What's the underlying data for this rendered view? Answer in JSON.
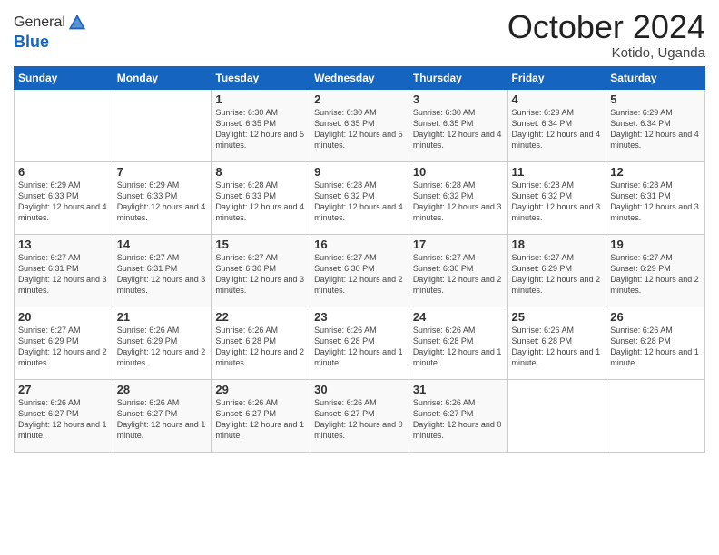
{
  "logo": {
    "general": "General",
    "blue": "Blue"
  },
  "header": {
    "month": "October 2024",
    "location": "Kotido, Uganda"
  },
  "weekdays": [
    "Sunday",
    "Monday",
    "Tuesday",
    "Wednesday",
    "Thursday",
    "Friday",
    "Saturday"
  ],
  "weeks": [
    [
      {
        "day": "",
        "info": ""
      },
      {
        "day": "",
        "info": ""
      },
      {
        "day": "1",
        "info": "Sunrise: 6:30 AM\nSunset: 6:35 PM\nDaylight: 12 hours\nand 5 minutes."
      },
      {
        "day": "2",
        "info": "Sunrise: 6:30 AM\nSunset: 6:35 PM\nDaylight: 12 hours\nand 5 minutes."
      },
      {
        "day": "3",
        "info": "Sunrise: 6:30 AM\nSunset: 6:35 PM\nDaylight: 12 hours\nand 4 minutes."
      },
      {
        "day": "4",
        "info": "Sunrise: 6:29 AM\nSunset: 6:34 PM\nDaylight: 12 hours\nand 4 minutes."
      },
      {
        "day": "5",
        "info": "Sunrise: 6:29 AM\nSunset: 6:34 PM\nDaylight: 12 hours\nand 4 minutes."
      }
    ],
    [
      {
        "day": "6",
        "info": "Sunrise: 6:29 AM\nSunset: 6:33 PM\nDaylight: 12 hours\nand 4 minutes."
      },
      {
        "day": "7",
        "info": "Sunrise: 6:29 AM\nSunset: 6:33 PM\nDaylight: 12 hours\nand 4 minutes."
      },
      {
        "day": "8",
        "info": "Sunrise: 6:28 AM\nSunset: 6:33 PM\nDaylight: 12 hours\nand 4 minutes."
      },
      {
        "day": "9",
        "info": "Sunrise: 6:28 AM\nSunset: 6:32 PM\nDaylight: 12 hours\nand 4 minutes."
      },
      {
        "day": "10",
        "info": "Sunrise: 6:28 AM\nSunset: 6:32 PM\nDaylight: 12 hours\nand 3 minutes."
      },
      {
        "day": "11",
        "info": "Sunrise: 6:28 AM\nSunset: 6:32 PM\nDaylight: 12 hours\nand 3 minutes."
      },
      {
        "day": "12",
        "info": "Sunrise: 6:28 AM\nSunset: 6:31 PM\nDaylight: 12 hours\nand 3 minutes."
      }
    ],
    [
      {
        "day": "13",
        "info": "Sunrise: 6:27 AM\nSunset: 6:31 PM\nDaylight: 12 hours\nand 3 minutes."
      },
      {
        "day": "14",
        "info": "Sunrise: 6:27 AM\nSunset: 6:31 PM\nDaylight: 12 hours\nand 3 minutes."
      },
      {
        "day": "15",
        "info": "Sunrise: 6:27 AM\nSunset: 6:30 PM\nDaylight: 12 hours\nand 3 minutes."
      },
      {
        "day": "16",
        "info": "Sunrise: 6:27 AM\nSunset: 6:30 PM\nDaylight: 12 hours\nand 2 minutes."
      },
      {
        "day": "17",
        "info": "Sunrise: 6:27 AM\nSunset: 6:30 PM\nDaylight: 12 hours\nand 2 minutes."
      },
      {
        "day": "18",
        "info": "Sunrise: 6:27 AM\nSunset: 6:29 PM\nDaylight: 12 hours\nand 2 minutes."
      },
      {
        "day": "19",
        "info": "Sunrise: 6:27 AM\nSunset: 6:29 PM\nDaylight: 12 hours\nand 2 minutes."
      }
    ],
    [
      {
        "day": "20",
        "info": "Sunrise: 6:27 AM\nSunset: 6:29 PM\nDaylight: 12 hours\nand 2 minutes."
      },
      {
        "day": "21",
        "info": "Sunrise: 6:26 AM\nSunset: 6:29 PM\nDaylight: 12 hours\nand 2 minutes."
      },
      {
        "day": "22",
        "info": "Sunrise: 6:26 AM\nSunset: 6:28 PM\nDaylight: 12 hours\nand 2 minutes."
      },
      {
        "day": "23",
        "info": "Sunrise: 6:26 AM\nSunset: 6:28 PM\nDaylight: 12 hours\nand 1 minute."
      },
      {
        "day": "24",
        "info": "Sunrise: 6:26 AM\nSunset: 6:28 PM\nDaylight: 12 hours\nand 1 minute."
      },
      {
        "day": "25",
        "info": "Sunrise: 6:26 AM\nSunset: 6:28 PM\nDaylight: 12 hours\nand 1 minute."
      },
      {
        "day": "26",
        "info": "Sunrise: 6:26 AM\nSunset: 6:28 PM\nDaylight: 12 hours\nand 1 minute."
      }
    ],
    [
      {
        "day": "27",
        "info": "Sunrise: 6:26 AM\nSunset: 6:27 PM\nDaylight: 12 hours\nand 1 minute."
      },
      {
        "day": "28",
        "info": "Sunrise: 6:26 AM\nSunset: 6:27 PM\nDaylight: 12 hours\nand 1 minute."
      },
      {
        "day": "29",
        "info": "Sunrise: 6:26 AM\nSunset: 6:27 PM\nDaylight: 12 hours\nand 1 minute."
      },
      {
        "day": "30",
        "info": "Sunrise: 6:26 AM\nSunset: 6:27 PM\nDaylight: 12 hours\nand 0 minutes."
      },
      {
        "day": "31",
        "info": "Sunrise: 6:26 AM\nSunset: 6:27 PM\nDaylight: 12 hours\nand 0 minutes."
      },
      {
        "day": "",
        "info": ""
      },
      {
        "day": "",
        "info": ""
      }
    ]
  ]
}
